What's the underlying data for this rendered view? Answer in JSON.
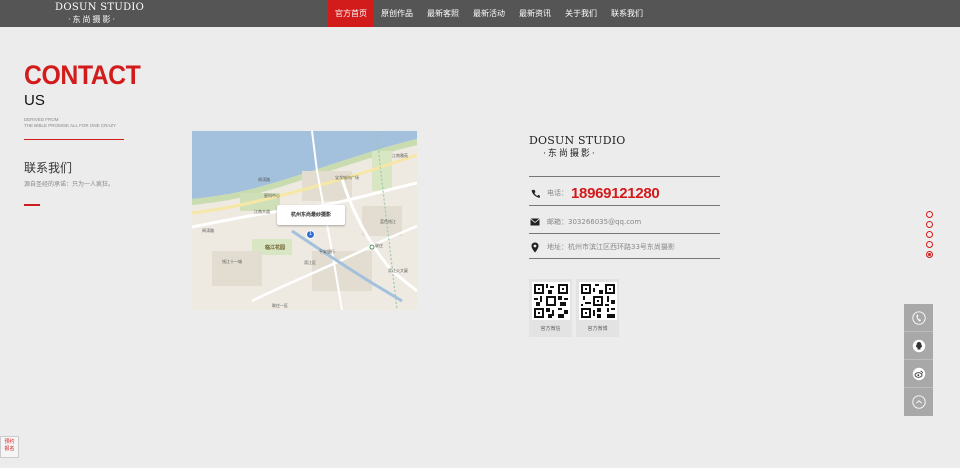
{
  "logo": {
    "en": "DOSUN STUDIO",
    "cn": "·东尚摄影·"
  },
  "nav": {
    "items": [
      {
        "label": "官方首页",
        "active": true
      },
      {
        "label": "原创作品",
        "active": false
      },
      {
        "label": "最新客照",
        "active": false
      },
      {
        "label": "最新活动",
        "active": false
      },
      {
        "label": "最新资讯",
        "active": false
      },
      {
        "label": "关于我们",
        "active": false
      },
      {
        "label": "联系我们",
        "active": false
      }
    ]
  },
  "left": {
    "contact": "CONTACT",
    "us": "US",
    "derived_line1": "DERIVED FROM",
    "derived_line2": "THE BIBLE PROMISE ALL FOR ONE CRAZY",
    "heading": "联系我们",
    "subtext": "源自圣经的承诺：只为一人疯狂。"
  },
  "map": {
    "popup": "杭州东尚最纱摄影",
    "pin_number": "1",
    "labels": {
      "road1": "闻涛路",
      "road2": "江南大道",
      "road3": "闻涛路",
      "park": "临江花园",
      "c1": "江南雅苑",
      "c2": "星科中心",
      "c3": "宝龙城市广场",
      "c4": "蓝色钱江",
      "c5": "联庄",
      "c6": "滨江区",
      "c7": "钱江十一城",
      "c8": "联庄一区",
      "c9": "平安银行",
      "c10": "滨江火大厦"
    }
  },
  "info": {
    "brand_en": "DOSUN STUDIO",
    "brand_cn": "·东尚摄影·",
    "phone_label": "电话：",
    "phone": "18969121280",
    "email_label": "邮箱：",
    "email": "303266035@qq.com",
    "address_label": "地址：",
    "address": "杭州市滨江区西环路33号东尚摄影"
  },
  "qr": [
    {
      "caption": "官方微信"
    },
    {
      "caption": "官方微博"
    }
  ],
  "appoint": {
    "line1": "预约",
    "line2": "报名"
  },
  "colors": {
    "accent": "#d21c1c",
    "topbar": "#555555",
    "background": "#ececec"
  }
}
